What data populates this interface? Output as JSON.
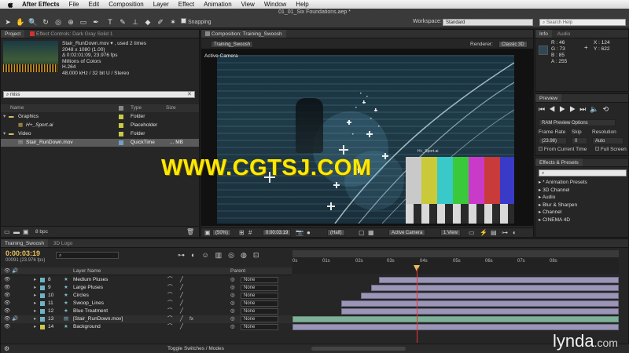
{
  "menubar": {
    "app": "After Effects",
    "items": [
      "File",
      "Edit",
      "Composition",
      "Layer",
      "Effect",
      "Animation",
      "View",
      "Window",
      "Help"
    ]
  },
  "window_title": "01_01_Six Foundations.aep *",
  "toolbar": {
    "snapping_label": "Snapping",
    "workspace_label": "Workspace:",
    "workspace_value": "Standard",
    "search_placeholder": "Search Help"
  },
  "project_panel": {
    "tab_project": "Project",
    "tab_effect_controls": "Effect Controls: Dark Gray Solid 1",
    "footage_name": "Stair_RunDown.mov ▾ , used 2 times",
    "footage_info": [
      "2048 x 1080 (1.00)",
      "Δ 0:02:01:09, 23.976 fps",
      "Millions of Colors",
      "H.264",
      "48.000 kHz / 32 bit U / Stereo"
    ],
    "search_value": "miss",
    "columns": {
      "name": "Name",
      "type": "Type",
      "size": "Size"
    },
    "items": [
      {
        "name": "Graphics",
        "type": "Folder",
        "size": "",
        "color": "#c8c84a"
      },
      {
        "name": "H+_Sport.ai",
        "type": "Placeholder",
        "size": "",
        "color": "#c8c84a"
      },
      {
        "name": "Video",
        "type": "Folder",
        "size": "",
        "color": "#c8c84a"
      },
      {
        "name": "Stair_RunDown.mov",
        "type": "QuickTime",
        "size": "... MB",
        "color": "#6fa1c4"
      }
    ],
    "bpc": "8 bpc"
  },
  "composition_panel": {
    "tab_label": "Composition: Training_Swoosh",
    "sub_tab": "Training_Swoosh",
    "renderer_label": "Renderer:",
    "renderer_value": "Classic 3D",
    "camera_label": "Active Camera",
    "footage_label": "H+_Sport.ai",
    "bottom": {
      "zoom": "(50%)",
      "timecode": "0:00:03:19",
      "resolution": "(Half)",
      "camera": "Active Camera",
      "view": "1 View"
    }
  },
  "info_panel": {
    "tab_info": "Info",
    "tab_audio": "Audio",
    "r": "R : 46",
    "g": "G : 73",
    "b": "B : 85",
    "a": "A : 255",
    "x": "X : 124",
    "y": "Y : 622"
  },
  "preview_panel": {
    "title": "Preview",
    "ram_options": "RAM Preview Options",
    "frame_rate_label": "Frame Rate",
    "skip_label": "Skip",
    "resolution_label": "Resolution",
    "frame_rate_value": "(23.98)",
    "skip_value": "0",
    "resolution_value": "Auto",
    "from_current": "From Current Time",
    "full_screen": "Full Screen"
  },
  "effects_panel": {
    "title": "Effects & Presets",
    "search_placeholder": "",
    "items": [
      "* Animation Presets",
      "3D Channel",
      "Audio",
      "Blur & Sharpen",
      "Channel",
      "CINEMA 4D"
    ]
  },
  "timeline": {
    "tab_main": "Training_Swoosh",
    "tab_logo": "3D Logo",
    "timecode": "0:00:03:19",
    "frame_info": "00091 (23.976 fps)",
    "columns": {
      "layer_name": "Layer Name",
      "parent": "Parent"
    },
    "ticks": [
      "0s",
      "01s",
      "02s",
      "03s",
      "04s",
      "05s",
      "06s",
      "07s",
      "08s"
    ],
    "layers": [
      {
        "num": "8",
        "name": "Medium Pluses",
        "parent": "None",
        "color": "#6fb4c4",
        "track_start": 0.265,
        "track_end": 1.0
      },
      {
        "num": "9",
        "name": "Large Pluses",
        "parent": "None",
        "color": "#6fb4c4",
        "track_start": 0.24,
        "track_end": 1.0
      },
      {
        "num": "10",
        "name": "Circles",
        "parent": "None",
        "color": "#6fb4c4",
        "track_start": 0.21,
        "track_end": 1.0
      },
      {
        "num": "11",
        "name": "Swoop_Lines",
        "parent": "None",
        "color": "#6fb4c4",
        "track_start": 0.15,
        "track_end": 1.0
      },
      {
        "num": "12",
        "name": "Blue Treatment",
        "parent": "None",
        "color": "#6fb4c4",
        "track_start": 0.15,
        "track_end": 1.0
      },
      {
        "num": "13",
        "name": "[Stair_RunDown.mov]",
        "parent": "None",
        "color": "#6fb4c4",
        "track_start": 0.0,
        "track_end": 1.0
      },
      {
        "num": "14",
        "name": "Background",
        "parent": "None",
        "color": "#c8c84a",
        "track_start": 0.0,
        "track_end": 1.0
      }
    ],
    "toggle_label": "Toggle Switches / Modes"
  },
  "watermark": "WWW.CGTSJ.COM",
  "brand": "lynda",
  "brand_suffix": ".com"
}
